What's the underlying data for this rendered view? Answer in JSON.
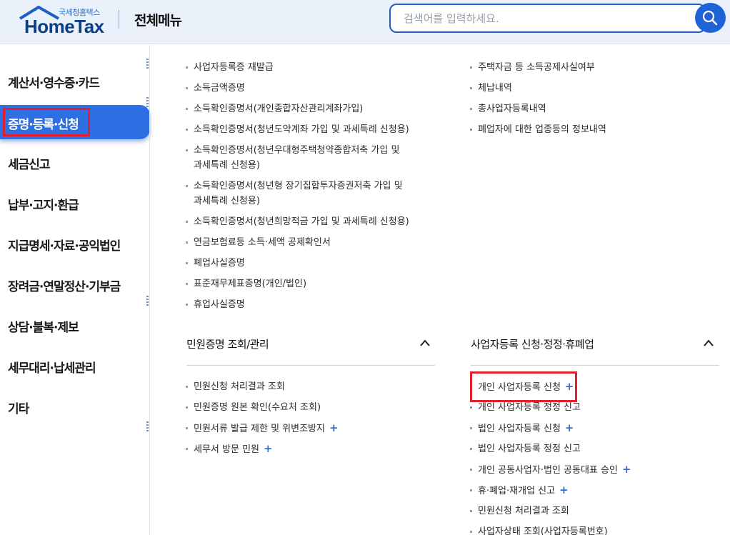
{
  "header": {
    "logo_sub": "국세청홈택스",
    "logo_main": "HomeTax",
    "title": "전체메뉴",
    "search_placeholder": "검색어를 입력하세요."
  },
  "sidebar": {
    "items": [
      {
        "label": "계산서·영수증·카드",
        "active": false
      },
      {
        "label": "증명·등록·신청",
        "active": true
      },
      {
        "label": "세금신고",
        "active": false
      },
      {
        "label": "납부·고지·환급",
        "active": false
      },
      {
        "label": "지급명세·자료·공익법인",
        "active": false
      },
      {
        "label": "장려금·연말정산·기부금",
        "active": false
      },
      {
        "label": "상담·불복·제보",
        "active": false
      },
      {
        "label": "세무대리·납세관리",
        "active": false
      },
      {
        "label": "기타",
        "active": false
      }
    ]
  },
  "col1_top": [
    "사업자등록증 재발급",
    "소득금액증명",
    "소득확인증명서(개인종합자산관리계좌가입)",
    "소득확인증명서(청년도약계좌 가입 및 과세특례 신청용)",
    "소득확인증명서(청년우대형주택청약종합저축 가입 및",
    "과세특례 신청용)",
    "소득확인증명서(청년형 장기집합투자증권저축 가입 및",
    "과세특례 신청용)",
    "소득확인증명서(청년희망적금 가입 및 과세특례 신청용)",
    "연금보험료등 소득·세액 공제확인서",
    "폐업사실증명",
    "표준재무제표증명(개인/법인)",
    "휴업사실증명"
  ],
  "col2_top": [
    "주택자금 등 소득공제사실여부",
    "체납내역",
    "총사업자등록내역",
    "폐업자에 대한 업종등의 정보내역"
  ],
  "section_left": {
    "title": "민원증명 조회/관리",
    "items": [
      {
        "label": "민원신청 처리결과 조회",
        "plus": ""
      },
      {
        "label": "민원증명 원본 확인(수요처 조회)",
        "plus": ""
      },
      {
        "label": "민원서류 발급 제한 및 위변조방지",
        "plus": "+"
      },
      {
        "label": "세무서 방문 민원",
        "plus": "+"
      }
    ]
  },
  "section_right": {
    "title": "사업자등록 신청·정정·휴폐업",
    "items": [
      {
        "label": "개인 사업자등록 신청",
        "plus": "+"
      },
      {
        "label": "개인 사업자등록 정정 신고",
        "plus": ""
      },
      {
        "label": "법인 사업자등록 신청",
        "plus": "+"
      },
      {
        "label": "법인 사업자등록 정정 신고",
        "plus": ""
      },
      {
        "label": "개인 공동사업자·법인 공동대표 승인",
        "plus": "+"
      },
      {
        "label": "휴·폐업·재개업 신고",
        "plus": "+"
      },
      {
        "label": "민원신청 처리결과 조회",
        "plus": ""
      },
      {
        "label": "사업자상태 조회(사업자등록번호)",
        "plus": ""
      }
    ]
  },
  "colors": {
    "accent": "#2f6fe4",
    "highlight": "#e0202a",
    "header_bg": "#ebf1fb",
    "plus": "#2c6fe0"
  }
}
